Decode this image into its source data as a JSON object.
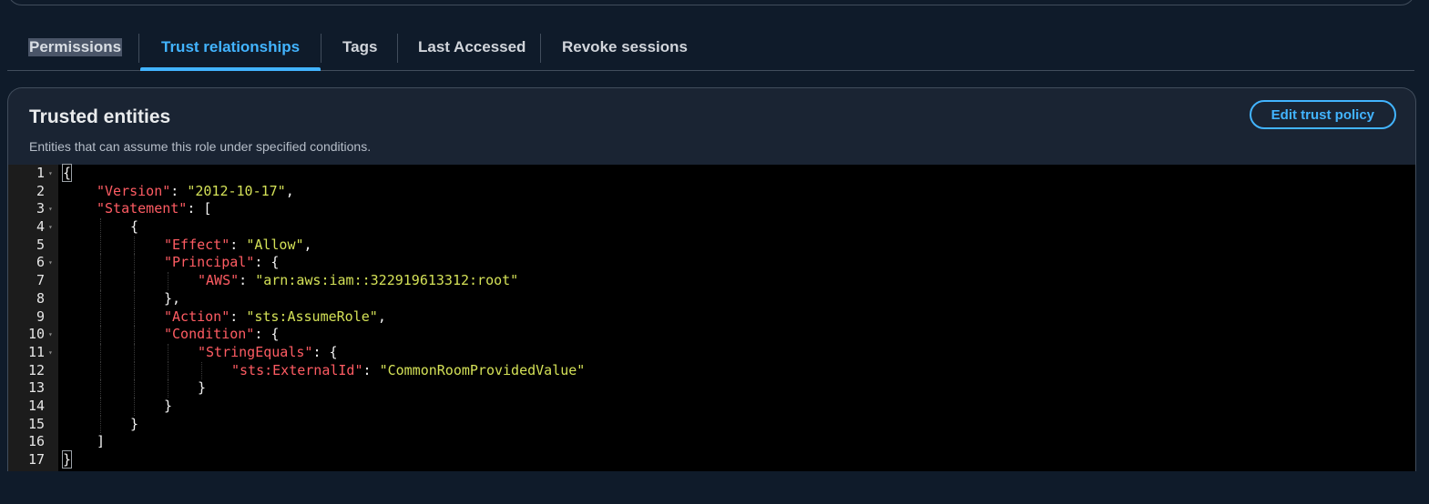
{
  "tabs": [
    {
      "label": "Permissions"
    },
    {
      "label": "Trust relationships"
    },
    {
      "label": "Tags"
    },
    {
      "label": "Last Accessed"
    },
    {
      "label": "Revoke sessions"
    }
  ],
  "active_tab": "Trust relationships",
  "panel": {
    "title": "Trusted entities",
    "description": "Entities that can assume this role under specified conditions.",
    "edit_button": "Edit trust policy"
  },
  "editor": {
    "lines": [
      {
        "n": "1",
        "fold": true,
        "indent": 0,
        "tokens": [
          [
            "p",
            "{"
          ]
        ]
      },
      {
        "n": "2",
        "fold": false,
        "indent": 1,
        "tokens": [
          [
            "k",
            "\"Version\""
          ],
          [
            "p",
            ": "
          ],
          [
            "s",
            "\"2012-10-17\""
          ],
          [
            "p",
            ","
          ]
        ]
      },
      {
        "n": "3",
        "fold": true,
        "indent": 1,
        "tokens": [
          [
            "k",
            "\"Statement\""
          ],
          [
            "p",
            ": ["
          ]
        ]
      },
      {
        "n": "4",
        "fold": true,
        "indent": 2,
        "tokens": [
          [
            "p",
            "{"
          ]
        ]
      },
      {
        "n": "5",
        "fold": false,
        "indent": 3,
        "tokens": [
          [
            "k",
            "\"Effect\""
          ],
          [
            "p",
            ": "
          ],
          [
            "s",
            "\"Allow\""
          ],
          [
            "p",
            ","
          ]
        ]
      },
      {
        "n": "6",
        "fold": true,
        "indent": 3,
        "tokens": [
          [
            "k",
            "\"Principal\""
          ],
          [
            "p",
            ": {"
          ]
        ]
      },
      {
        "n": "7",
        "fold": false,
        "indent": 4,
        "tokens": [
          [
            "k",
            "\"AWS\""
          ],
          [
            "p",
            ": "
          ],
          [
            "s",
            "\"arn:aws:iam::322919613312:root\""
          ]
        ]
      },
      {
        "n": "8",
        "fold": false,
        "indent": 3,
        "tokens": [
          [
            "p",
            "},"
          ]
        ]
      },
      {
        "n": "9",
        "fold": false,
        "indent": 3,
        "tokens": [
          [
            "k",
            "\"Action\""
          ],
          [
            "p",
            ": "
          ],
          [
            "s",
            "\"sts:AssumeRole\""
          ],
          [
            "p",
            ","
          ]
        ]
      },
      {
        "n": "10",
        "fold": true,
        "indent": 3,
        "tokens": [
          [
            "k",
            "\"Condition\""
          ],
          [
            "p",
            ": {"
          ]
        ]
      },
      {
        "n": "11",
        "fold": true,
        "indent": 4,
        "tokens": [
          [
            "k",
            "\"StringEquals\""
          ],
          [
            "p",
            ": {"
          ]
        ]
      },
      {
        "n": "12",
        "fold": false,
        "indent": 5,
        "tokens": [
          [
            "k",
            "\"sts:ExternalId\""
          ],
          [
            "p",
            ": "
          ],
          [
            "s",
            "\"CommonRoomProvidedValue\""
          ]
        ]
      },
      {
        "n": "13",
        "fold": false,
        "indent": 4,
        "tokens": [
          [
            "p",
            "}"
          ]
        ]
      },
      {
        "n": "14",
        "fold": false,
        "indent": 3,
        "tokens": [
          [
            "p",
            "}"
          ]
        ]
      },
      {
        "n": "15",
        "fold": false,
        "indent": 2,
        "tokens": [
          [
            "p",
            "}"
          ]
        ]
      },
      {
        "n": "16",
        "fold": false,
        "indent": 1,
        "tokens": [
          [
            "p",
            "]"
          ]
        ]
      },
      {
        "n": "17",
        "fold": false,
        "indent": 0,
        "tokens": [
          [
            "p",
            "}"
          ]
        ]
      }
    ]
  }
}
